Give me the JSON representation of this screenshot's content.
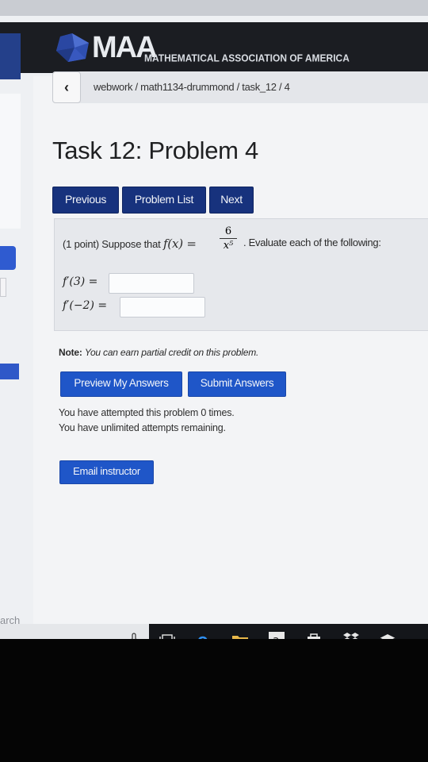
{
  "header": {
    "logo_text": "MAA",
    "logo_subtitle": "MATHEMATICAL ASSOCIATION OF AMERICA"
  },
  "breadcrumb": {
    "back_label": "‹",
    "path": "webwork / math1134-drummond / task_12 / 4"
  },
  "page": {
    "title": "Task 12: Problem 4"
  },
  "nav": {
    "previous": "Previous",
    "problem_list": "Problem List",
    "next": "Next"
  },
  "problem": {
    "intro": "(1 point) Suppose that",
    "function_lhs": "f(x) =",
    "numerator": "6",
    "denominator": "x⁵",
    "instruction": ". Evaluate each of the following:",
    "answers": [
      {
        "label": "f′(3) =",
        "value": ""
      },
      {
        "label": "f′(−2) =",
        "value": ""
      }
    ]
  },
  "note": {
    "label": "Note:",
    "text": "You can earn partial credit on this problem."
  },
  "actions": {
    "preview": "Preview My Answers",
    "submit": "Submit Answers"
  },
  "status": {
    "attempts": "You have attempted this problem 0 times.",
    "remaining": "You have unlimited attempts remaining."
  },
  "email": {
    "label": "Email instructor"
  },
  "taskbar": {
    "search_fragment": "arch",
    "icons": [
      "microphone-icon",
      "task-view-icon",
      "edge-icon",
      "file-explorer-icon",
      "amazon-icon",
      "store-icon",
      "dropbox-icon",
      "mail-icon"
    ]
  },
  "colors": {
    "nav_button": "#17327d",
    "action_button": "#1f56c8",
    "header": "#1b1d22",
    "panel": "#e6e8ec"
  }
}
